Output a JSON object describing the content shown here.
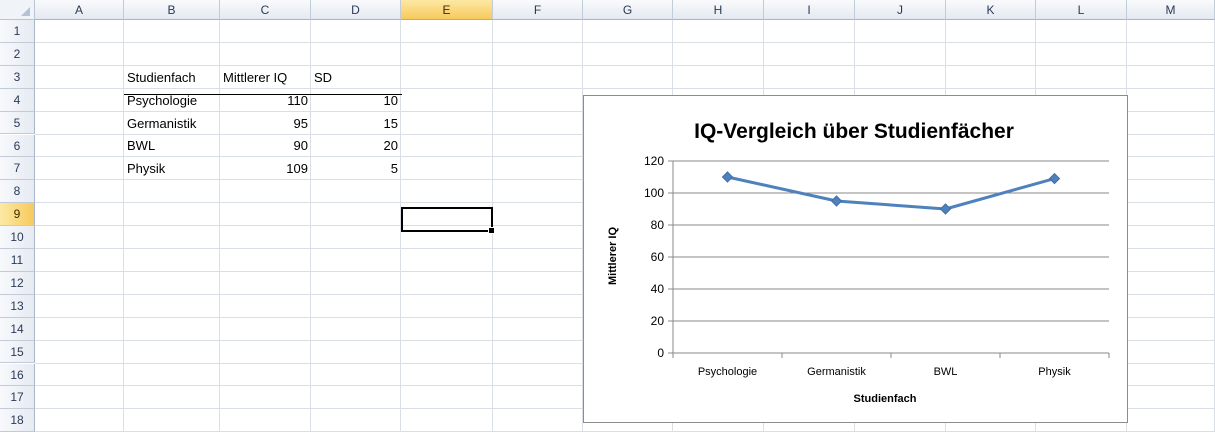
{
  "sheet": {
    "columns": [
      "A",
      "B",
      "C",
      "D",
      "E",
      "F",
      "G",
      "H",
      "I",
      "J",
      "K",
      "L",
      "M"
    ],
    "rows": [
      "1",
      "2",
      "3",
      "4",
      "5",
      "6",
      "7",
      "8",
      "9",
      "10",
      "11",
      "12",
      "13",
      "14",
      "15",
      "16",
      "17",
      "18"
    ],
    "selected_column": "E",
    "selected_row": "9",
    "table": {
      "headers": [
        "Studienfach",
        "Mittlerer IQ",
        "SD"
      ],
      "rows": [
        [
          "Psychologie",
          "110",
          "10"
        ],
        [
          "Germanistik",
          "95",
          "15"
        ],
        [
          "BWL",
          "90",
          "20"
        ],
        [
          "Physik",
          "109",
          "5"
        ]
      ]
    }
  },
  "chart_data": {
    "type": "line",
    "title": "IQ-Vergleich über Studienfächer",
    "xlabel": "Studienfach",
    "ylabel": "Mittlerer IQ",
    "categories": [
      "Psychologie",
      "Germanistik",
      "BWL",
      "Physik"
    ],
    "series": [
      {
        "values": [
          110,
          95,
          90,
          109
        ]
      }
    ],
    "ylim": [
      0,
      120
    ],
    "yticks": [
      0,
      20,
      40,
      60,
      80,
      100,
      120
    ],
    "grid": true,
    "line_color": "#4f81bd"
  }
}
